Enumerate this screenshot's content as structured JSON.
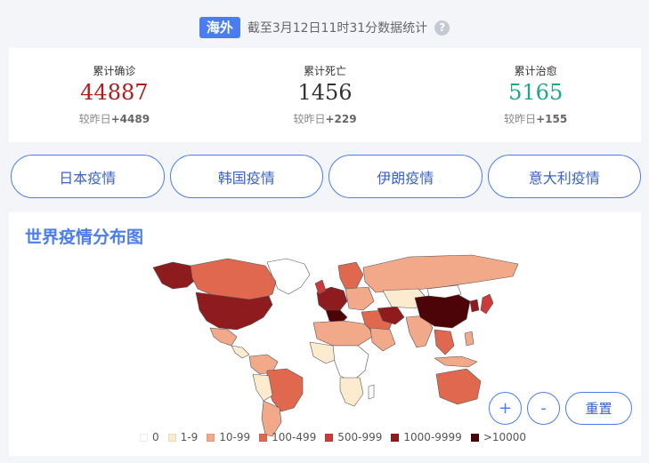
{
  "header": {
    "region_tag": "海外",
    "stat_time": "截至3月12日11时31分数据统计",
    "help_icon": "question-icon"
  },
  "stats": [
    {
      "label": "累计确诊",
      "value": "44887",
      "delta_prefix": "较昨日",
      "delta": "+4489",
      "color": "#b01c1c"
    },
    {
      "label": "累计死亡",
      "value": "1456",
      "delta_prefix": "较昨日",
      "delta": "+229",
      "color": "#333333"
    },
    {
      "label": "累计治愈",
      "value": "5165",
      "delta_prefix": "较昨日",
      "delta": "+155",
      "color": "#1aa78a"
    }
  ],
  "tabs": [
    "日本疫情",
    "韩国疫情",
    "伊朗疫情",
    "意大利疫情"
  ],
  "map": {
    "title": "世界疫情分布图",
    "zoom_in_label": "+",
    "zoom_out_label": "-",
    "reset_label": "重置",
    "legend": [
      {
        "label": "0",
        "color": "#ffffff"
      },
      {
        "label": "1-9",
        "color": "#fdebcf"
      },
      {
        "label": "10-99",
        "color": "#f2a98a"
      },
      {
        "label": "100-499",
        "color": "#e0684f"
      },
      {
        "label": "500-999",
        "color": "#cc3b3b"
      },
      {
        "label": "1000-9999",
        "color": "#8e1c1f"
      },
      {
        "label": ">10000",
        "color": "#4d0408"
      }
    ]
  }
}
